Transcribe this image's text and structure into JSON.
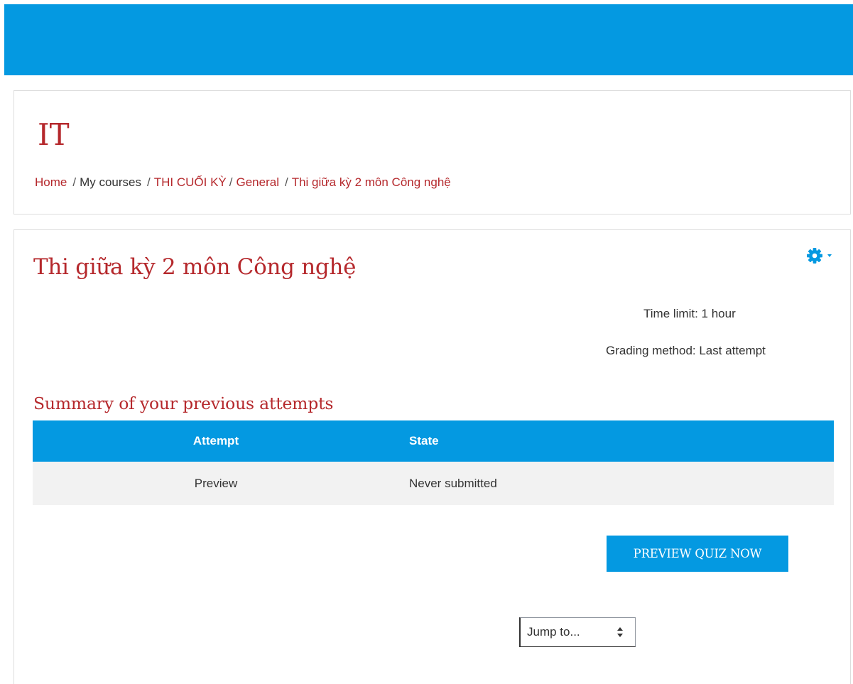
{
  "colors": {
    "brand_blue": "#0499e1",
    "accent_red": "#b5282c",
    "table_row_bg": "#f2f2f2"
  },
  "site": {
    "title": "IT"
  },
  "breadcrumb": {
    "items": [
      {
        "label": "Home",
        "link": true
      },
      {
        "label": "My courses",
        "link": false
      },
      {
        "label": "THI CUỐI KỲ",
        "link": true
      },
      {
        "label": "General",
        "link": true
      },
      {
        "label": "Thi giữa kỳ 2 môn Công nghệ",
        "link": true
      }
    ],
    "separator": "/"
  },
  "quiz": {
    "title": "Thi giữa kỳ 2 môn Công nghệ",
    "time_limit": "Time limit: 1 hour",
    "grading_method": "Grading method: Last attempt",
    "settings_icon": "gear-icon"
  },
  "summary": {
    "heading": "Summary of your previous attempts",
    "columns": [
      "Attempt",
      "State"
    ],
    "rows": [
      [
        "Preview",
        "Never submitted"
      ]
    ]
  },
  "actions": {
    "preview_button": "PREVIEW QUIZ NOW"
  },
  "jump_menu": {
    "selected": "Jump to...",
    "icon": "updown-arrows-icon"
  }
}
